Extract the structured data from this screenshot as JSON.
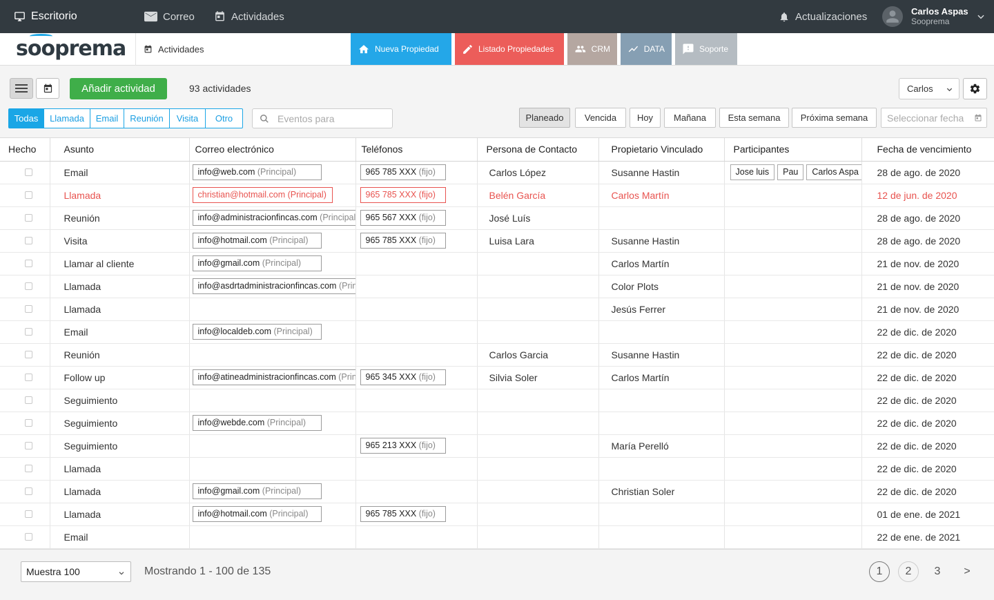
{
  "topbar": {
    "desktop": "Escritorio",
    "mail": "Correo",
    "activities": "Actividades",
    "updates": "Actualizaciones",
    "user_name": "Carlos Aspas",
    "user_org": "Sooprema"
  },
  "navbar": {
    "logo": "sooprema",
    "current": "Actividades",
    "buttons": [
      {
        "label": "Nueva Propiedad",
        "color": "#24a7e8",
        "icon": "home-icon"
      },
      {
        "label": "Listado Propiedades",
        "color": "#ec5d5a",
        "icon": "pencil-icon"
      },
      {
        "label": "CRM",
        "color": "#b5a7a1",
        "icon": "people-icon"
      },
      {
        "label": "DATA",
        "color": "#869fb3",
        "icon": "trend-icon"
      },
      {
        "label": "Soporte",
        "color": "#b5bcc2",
        "icon": "chat-alert-icon"
      }
    ]
  },
  "toolbar": {
    "add_label": "Añadir actividad",
    "count": "93 actividades",
    "user_filter": "Carlos",
    "type_filters": [
      "Todas",
      "Llamada",
      "Email",
      "Reunión",
      "Visita",
      "Otro"
    ],
    "search_placeholder": "Eventos para",
    "time_filters": [
      "Planeado",
      "Vencida",
      "Hoy",
      "Mañana",
      "Esta semana",
      "Próxima semana"
    ],
    "date_placeholder": "Seleccionar fecha"
  },
  "table": {
    "headers": [
      "Hecho",
      "Asunto",
      "Correo electrónico",
      "Teléfonos",
      "Persona de Contacto",
      "Propietario Vinculado",
      "Participantes",
      "Fecha de vencimiento"
    ],
    "rows": [
      {
        "subject": "Email",
        "email": "info@web.com",
        "email_tag": "(Principal)",
        "phone": "965 785 XXX",
        "phone_tag": "(fijo)",
        "contact": "Carlos López",
        "owner": "Susanne Hastin",
        "participants": [
          "Jose luis",
          "Pau",
          "Carlos Aspa"
        ],
        "due": "28 de ago. de 2020",
        "overdue": false
      },
      {
        "subject": "Llamada",
        "email": "christian@hotmail.com",
        "email_tag": "(Principal)",
        "phone": "965 785 XXX",
        "phone_tag": "(fijo)",
        "contact": "Belén García",
        "owner": "Carlos Martín",
        "participants": [],
        "due": "12 de jun. de 2020",
        "overdue": true
      },
      {
        "subject": "Reunión",
        "email": "info@administracionfincas.com",
        "email_tag": "(Principal)",
        "phone": "965 567 XXX",
        "phone_tag": "(fijo)",
        "contact": "José Luís",
        "owner": "",
        "participants": [],
        "due": "28 de ago. de 2020",
        "overdue": false
      },
      {
        "subject": "Visita",
        "email": "info@hotmail.com",
        "email_tag": "(Principal)",
        "phone": "965 785 XXX",
        "phone_tag": "(fijo)",
        "contact": "Luisa Lara",
        "owner": "Susanne Hastin",
        "participants": [],
        "due": "28 de ago. de 2020",
        "overdue": false
      },
      {
        "subject": "Llamar al cliente",
        "email": "info@gmail.com",
        "email_tag": "(Principal)",
        "phone": "",
        "phone_tag": "",
        "contact": "",
        "owner": "Carlos Martín",
        "participants": [],
        "due": "21 de nov. de 2020",
        "overdue": false
      },
      {
        "subject": "Llamada",
        "email": "info@asdrtadministracionfincas.com",
        "email_tag": "(Principal)",
        "phone": "",
        "phone_tag": "",
        "contact": "",
        "owner": "Color Plots",
        "participants": [],
        "due": "21 de nov. de 2020",
        "overdue": false
      },
      {
        "subject": "Llamada",
        "email": "",
        "email_tag": "",
        "phone": "",
        "phone_tag": "",
        "contact": "",
        "owner": "Jesús Ferrer",
        "participants": [],
        "due": "21 de nov. de 2020",
        "overdue": false
      },
      {
        "subject": "Email",
        "email": "info@localdeb.com",
        "email_tag": "(Principal)",
        "phone": "",
        "phone_tag": "",
        "contact": "",
        "owner": "",
        "participants": [],
        "due": "22 de dic. de 2020",
        "overdue": false
      },
      {
        "subject": "Reunión",
        "email": "",
        "email_tag": "",
        "phone": "",
        "phone_tag": "",
        "contact": "Carlos Garcia",
        "owner": "Susanne Hastin",
        "participants": [],
        "due": "22 de dic. de 2020",
        "overdue": false
      },
      {
        "subject": "Follow up",
        "email": "info@atineadministracionfincas.com",
        "email_tag": "(Principal)",
        "phone": "965 345 XXX",
        "phone_tag": "(fijo)",
        "contact": "Silvia Soler",
        "owner": "Carlos Martín",
        "participants": [],
        "due": "22 de dic. de 2020",
        "overdue": false
      },
      {
        "subject": "Seguimiento",
        "email": "",
        "email_tag": "",
        "phone": "",
        "phone_tag": "",
        "contact": "",
        "owner": "",
        "participants": [],
        "due": "22 de dic. de 2020",
        "overdue": false
      },
      {
        "subject": "Seguimiento",
        "email": "info@webde.com",
        "email_tag": "(Principal)",
        "phone": "",
        "phone_tag": "",
        "contact": "",
        "owner": "",
        "participants": [],
        "due": "22 de dic. de 2020",
        "overdue": false
      },
      {
        "subject": "Seguimiento",
        "email": "",
        "email_tag": "",
        "phone": "965 213 XXX",
        "phone_tag": "(fijo)",
        "contact": "",
        "owner": "María Perelló",
        "participants": [],
        "due": "22 de dic. de 2020",
        "overdue": false
      },
      {
        "subject": "Llamada",
        "email": "",
        "email_tag": "",
        "phone": "",
        "phone_tag": "",
        "contact": "",
        "owner": "",
        "participants": [],
        "due": "22 de dic. de 2020",
        "overdue": false
      },
      {
        "subject": "Llamada",
        "email": "info@gmail.com",
        "email_tag": "(Principal)",
        "phone": "",
        "phone_tag": "",
        "contact": "",
        "owner": "Christian Soler",
        "participants": [],
        "due": "22 de dic. de 2020",
        "overdue": false
      },
      {
        "subject": "Llamada",
        "email": "info@hotmail.com",
        "email_tag": "(Principal)",
        "phone": "965 785 XXX",
        "phone_tag": "(fijo)",
        "contact": "",
        "owner": "",
        "participants": [],
        "due": "01 de ene. de 2021",
        "overdue": false
      },
      {
        "subject": "Email",
        "email": "",
        "email_tag": "",
        "phone": "",
        "phone_tag": "",
        "contact": "",
        "owner": "",
        "participants": [],
        "due": "22 de ene. de 2021",
        "overdue": false
      }
    ]
  },
  "footer": {
    "page_size": "Muestra 100",
    "showing": "Mostrando 1 - 100 de 135",
    "pages": [
      "1",
      "2",
      "3",
      ">"
    ]
  },
  "colors": {
    "accent_blue": "#1aa6e6",
    "add_green": "#3fae49",
    "overdue_red": "#e8534f",
    "topbar": "#323a40"
  }
}
